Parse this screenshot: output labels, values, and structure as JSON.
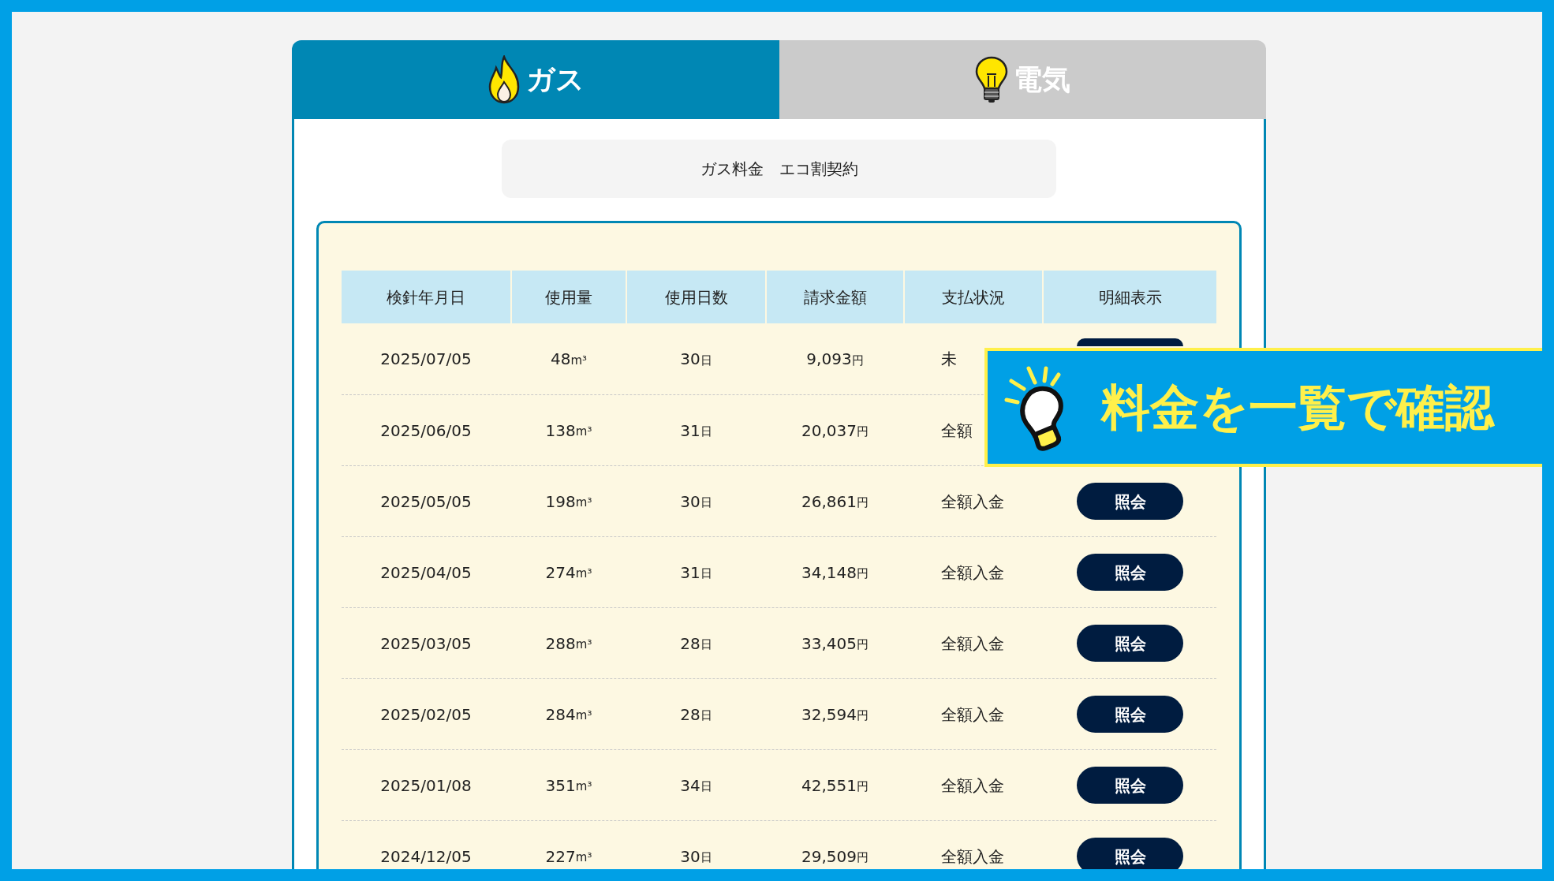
{
  "tabs": [
    {
      "label": "ガス",
      "kind": "flame",
      "selected": true
    },
    {
      "label": "電気",
      "kind": "bulb",
      "selected": false
    }
  ],
  "plan": "ガス料金　エコ割契約",
  "table": {
    "columns": [
      "検針年月日",
      "使用量",
      "使用日数",
      "請求金額",
      "支払状況",
      "明細表示"
    ],
    "rows": [
      {
        "date": "2025/07/05",
        "usage": "48",
        "usage_unit": "m³",
        "days": "30",
        "days_unit": "日",
        "amount": "9,093",
        "amount_unit": "円",
        "status": "未",
        "button_shown": true
      },
      {
        "date": "2025/06/05",
        "usage": "138",
        "usage_unit": "m³",
        "days": "31",
        "days_unit": "日",
        "amount": "20,037",
        "amount_unit": "円",
        "status": "全額",
        "button_shown": false
      },
      {
        "date": "2025/05/05",
        "usage": "198",
        "usage_unit": "m³",
        "days": "30",
        "days_unit": "日",
        "amount": "26,861",
        "amount_unit": "円",
        "status": "全額入金",
        "button": "照会"
      },
      {
        "date": "2025/04/05",
        "usage": "274",
        "usage_unit": "m³",
        "days": "31",
        "days_unit": "日",
        "amount": "34,148",
        "amount_unit": "円",
        "status": "全額入金",
        "button": "照会"
      },
      {
        "date": "2025/03/05",
        "usage": "288",
        "usage_unit": "m³",
        "days": "28",
        "days_unit": "日",
        "amount": "33,405",
        "amount_unit": "円",
        "status": "全額入金",
        "button": "照会"
      },
      {
        "date": "2025/02/05",
        "usage": "284",
        "usage_unit": "m³",
        "days": "28",
        "days_unit": "日",
        "amount": "32,594",
        "amount_unit": "円",
        "status": "全額入金",
        "button": "照会"
      },
      {
        "date": "2025/01/08",
        "usage": "351",
        "usage_unit": "m³",
        "days": "34",
        "days_unit": "日",
        "amount": "42,551",
        "amount_unit": "円",
        "status": "全額入金",
        "button": "照会"
      },
      {
        "date": "2024/12/05",
        "usage": "227",
        "usage_unit": "m³",
        "days": "30",
        "days_unit": "日",
        "amount": "29,509",
        "amount_unit": "円",
        "status": "全額入金",
        "button": "照会"
      }
    ]
  },
  "banner": {
    "text": "料金を一覧で確認"
  }
}
